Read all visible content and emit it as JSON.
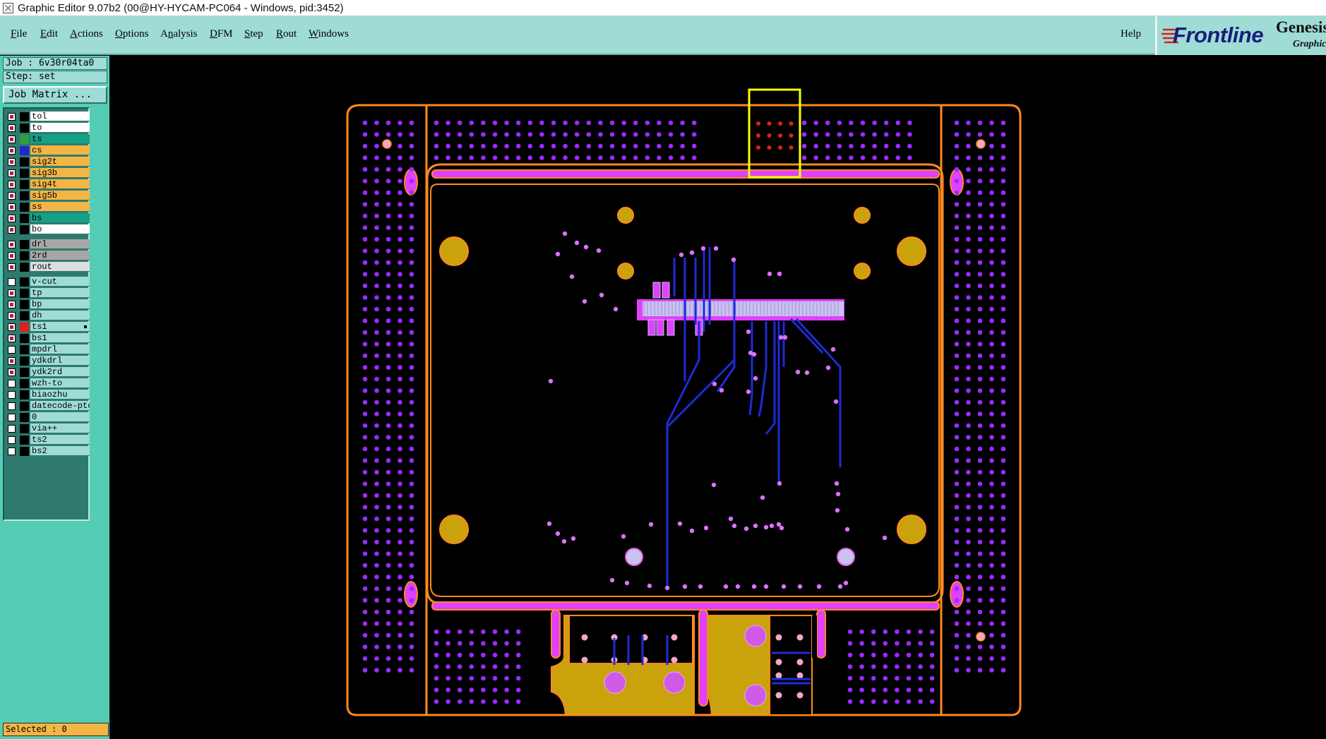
{
  "window": {
    "title": "Graphic Editor 9.07b2 (00@HY-HYCAM-PC064 - Windows, pid:3452)"
  },
  "menu": {
    "items": [
      {
        "label": "File",
        "key": "F"
      },
      {
        "label": "Edit",
        "key": "E"
      },
      {
        "label": "Actions",
        "key": "A"
      },
      {
        "label": "Options",
        "key": "O"
      },
      {
        "label": "Analysis",
        "key": "n"
      },
      {
        "label": "DFM",
        "key": "D"
      },
      {
        "label": "Step",
        "key": "S"
      },
      {
        "label": "Rout",
        "key": "R"
      },
      {
        "label": "Windows",
        "key": "W"
      }
    ],
    "help": "Help"
  },
  "logo": {
    "brand": "Frontline",
    "product": "Genesis",
    "subproduct": "Graphic"
  },
  "job": {
    "label": "Job : 6v30r04ta0",
    "step": "Step: set"
  },
  "job_matrix_button": "Job Matrix ...",
  "layers": [
    {
      "name": "tol",
      "checked": true,
      "swatch": "#000000",
      "bg": "#ffffff"
    },
    {
      "name": "to",
      "checked": true,
      "swatch": "#000000",
      "bg": "#ffffff"
    },
    {
      "name": "ts",
      "checked": true,
      "swatch": "#2fa038",
      "bg": "#16a085"
    },
    {
      "name": "cs",
      "checked": true,
      "swatch": "#2028d0",
      "bg": "#f3b544"
    },
    {
      "name": "sig2t",
      "checked": true,
      "swatch": "#000000",
      "bg": "#f3b544"
    },
    {
      "name": "sig3b",
      "checked": true,
      "swatch": "#000000",
      "bg": "#f3b544"
    },
    {
      "name": "sig4t",
      "checked": true,
      "swatch": "#000000",
      "bg": "#f3b544"
    },
    {
      "name": "sig5b",
      "checked": true,
      "swatch": "#000000",
      "bg": "#f3b544"
    },
    {
      "name": "ss",
      "checked": true,
      "swatch": "#000000",
      "bg": "#f3b544"
    },
    {
      "name": "bs",
      "checked": true,
      "swatch": "#000000",
      "bg": "#16a085"
    },
    {
      "name": "bo",
      "checked": true,
      "swatch": "#000000",
      "bg": "#ffffff"
    },
    {
      "name": "drl",
      "checked": true,
      "swatch": "#000000",
      "bg": "#a7a7a7",
      "gap": true
    },
    {
      "name": "2rd",
      "checked": true,
      "swatch": "#000000",
      "bg": "#a7a7a7"
    },
    {
      "name": "rout",
      "checked": true,
      "swatch": "#000000",
      "bg": "#dddddd"
    },
    {
      "name": "v-cut",
      "checked": false,
      "swatch": "#000000",
      "bg": "#9fdcd6",
      "gap": true
    },
    {
      "name": "tp",
      "checked": true,
      "swatch": "#000000",
      "bg": "#9fdcd6"
    },
    {
      "name": "bp",
      "checked": true,
      "swatch": "#000000",
      "bg": "#9fdcd6"
    },
    {
      "name": "dh",
      "checked": true,
      "swatch": "#000000",
      "bg": "#9fdcd6"
    },
    {
      "name": "ts1",
      "checked": true,
      "swatch": "#e0201e",
      "bg": "#9fdcd6",
      "mark": true
    },
    {
      "name": "bs1",
      "checked": true,
      "swatch": "#000000",
      "bg": "#9fdcd6"
    },
    {
      "name": "mpdrl",
      "checked": false,
      "swatch": "#000000",
      "bg": "#9fdcd6"
    },
    {
      "name": "ydkdrl",
      "checked": true,
      "swatch": "#000000",
      "bg": "#9fdcd6"
    },
    {
      "name": "ydk2rd",
      "checked": true,
      "swatch": "#000000",
      "bg": "#9fdcd6"
    },
    {
      "name": "wzh-to",
      "checked": false,
      "swatch": "#000000",
      "bg": "#9fdcd6"
    },
    {
      "name": "biaozhu",
      "checked": false,
      "swatch": "#000000",
      "bg": "#9fdcd6"
    },
    {
      "name": "datecode-ptc",
      "checked": false,
      "swatch": "#000000",
      "bg": "#9fdcd6"
    },
    {
      "name": "0",
      "checked": false,
      "swatch": "#000000",
      "bg": "#9fdcd6"
    },
    {
      "name": "via++",
      "checked": false,
      "swatch": "#000000",
      "bg": "#9fdcd6"
    },
    {
      "name": "ts2",
      "checked": false,
      "swatch": "#000000",
      "bg": "#9fdcd6"
    },
    {
      "name": "bs2",
      "checked": false,
      "swatch": "#000000",
      "bg": "#9fdcd6"
    }
  ],
  "selected": "Selected : 0",
  "colors": {
    "outline": "#ff8a1e",
    "via": "#9b2cff",
    "pad": "#e040ff",
    "trace": "#1e2bd6",
    "copper": "#c9a20c",
    "highlight": "#ffff00",
    "highlight_dots": "#e0201e"
  }
}
